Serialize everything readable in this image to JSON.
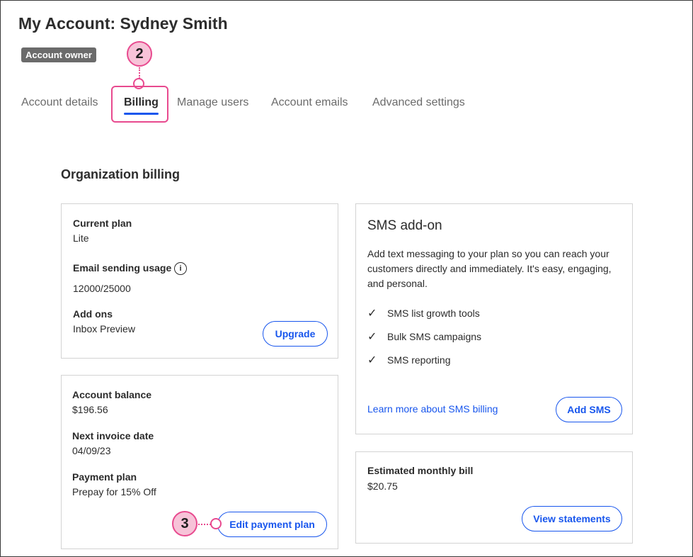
{
  "header": {
    "title": "My Account: Sydney Smith",
    "badge": "Account owner"
  },
  "tabs": [
    {
      "label": "Account details"
    },
    {
      "label": "Billing"
    },
    {
      "label": "Manage users"
    },
    {
      "label": "Account emails"
    },
    {
      "label": "Advanced settings"
    }
  ],
  "callouts": {
    "tab_step": "2",
    "edit_step": "3"
  },
  "section": {
    "title": "Organization billing"
  },
  "plan_card": {
    "current_plan_label": "Current plan",
    "current_plan_value": "Lite",
    "usage_label": "Email sending usage",
    "usage_info_icon": "info-icon",
    "usage_value": "12000/25000",
    "addons_label": "Add ons",
    "addons_value": "Inbox Preview",
    "upgrade_button": "Upgrade"
  },
  "balance_card": {
    "balance_label": "Account balance",
    "balance_value": "$196.56",
    "invoice_label": "Next invoice date",
    "invoice_value": "04/09/23",
    "payment_label": "Payment plan",
    "payment_value": "Prepay for 15% Off",
    "edit_button": "Edit payment plan"
  },
  "sms_card": {
    "title": "SMS add-on",
    "description": "Add text messaging to your plan so you can reach your customers directly and immediately. It's easy, engaging, and personal.",
    "features": [
      "SMS list growth tools",
      "Bulk SMS campaigns",
      "SMS reporting"
    ],
    "learn_link": "Learn more about SMS billing",
    "add_button": "Add SMS"
  },
  "bill_card": {
    "label": "Estimated monthly bill",
    "value": "$20.75",
    "statements_button": "View statements"
  },
  "colors": {
    "accent": "#1856ed",
    "callout": "#e84a8f",
    "badge": "#6b6b6b"
  }
}
